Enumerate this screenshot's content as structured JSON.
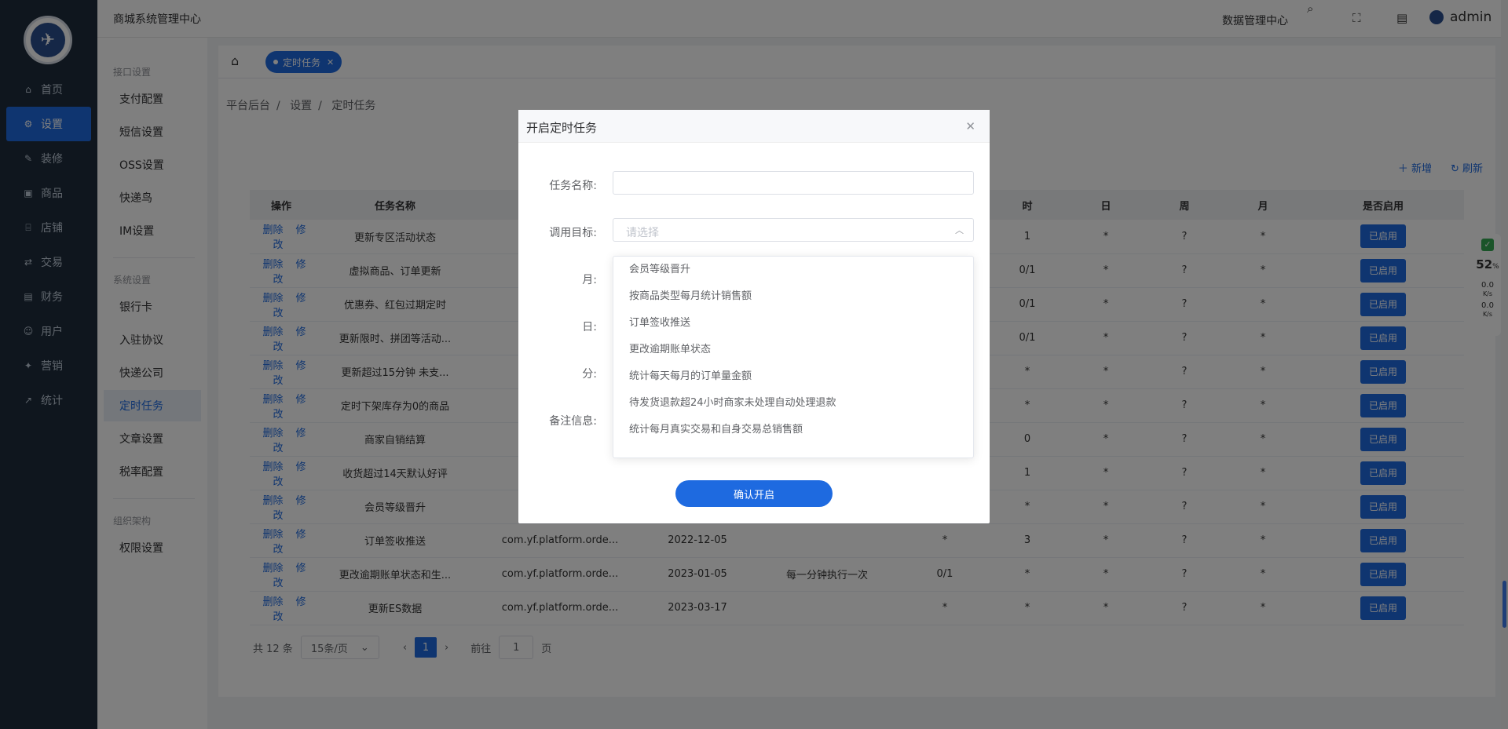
{
  "nav": {
    "items": [
      {
        "label": "首页",
        "icon": "home-icon",
        "glyph": "⌂"
      },
      {
        "label": "设置",
        "icon": "gear-icon",
        "glyph": "⚙"
      },
      {
        "label": "装修",
        "icon": "decorate-icon",
        "glyph": "✎"
      },
      {
        "label": "商品",
        "icon": "goods-icon",
        "glyph": "▣"
      },
      {
        "label": "店铺",
        "icon": "store-icon",
        "glyph": "⌸"
      },
      {
        "label": "交易",
        "icon": "trade-icon",
        "glyph": "⇄"
      },
      {
        "label": "财务",
        "icon": "finance-icon",
        "glyph": "▤"
      },
      {
        "label": "用户",
        "icon": "user-icon",
        "glyph": "☺"
      },
      {
        "label": "营销",
        "icon": "marketing-icon",
        "glyph": "✦"
      },
      {
        "label": "统计",
        "icon": "stats-icon",
        "glyph": "↗"
      }
    ],
    "active_index": 1
  },
  "subnav": {
    "group1": "接口设置",
    "group1_items": [
      "支付配置",
      "短信设置",
      "OSS设置",
      "快递鸟",
      "IM设置"
    ],
    "group2": "系统设置",
    "group2_items": [
      "银行卡",
      "入驻协议",
      "快递公司",
      "定时任务",
      "文章设置",
      "税率配置"
    ],
    "group3": "组织架构",
    "group3_items": [
      "权限设置"
    ]
  },
  "header": {
    "title": "商城系统管理中心",
    "data_center": "数据管理中心",
    "user": "admin"
  },
  "tabs": {
    "active": "定时任务"
  },
  "breadcrumb": [
    "平台后台",
    "设置",
    "定时任务"
  ],
  "toolbar": {
    "add": "＋ 新增",
    "refresh": "↻ 刷新"
  },
  "table": {
    "columns": [
      "操作",
      "任务名称",
      "",
      "",
      "",
      "",
      "时",
      "日",
      "周",
      "月",
      "是否启用"
    ],
    "actions": {
      "delete": "删除",
      "edit": "修改"
    },
    "enabled_label": "已启用",
    "rows": [
      {
        "name": "更新专区活动状态",
        "target": "",
        "date": "",
        "desc": "",
        "min": "",
        "hour": "1",
        "day": "*",
        "week": "?",
        "month": "*"
      },
      {
        "name": "虚拟商品、订单更新",
        "target": "",
        "date": "",
        "desc": "",
        "min": "",
        "hour": "0/1",
        "day": "*",
        "week": "?",
        "month": "*"
      },
      {
        "name": "优惠券、红包过期定时",
        "target": "",
        "date": "",
        "desc": "",
        "min": "",
        "hour": "0/1",
        "day": "*",
        "week": "?",
        "month": "*"
      },
      {
        "name": "更新限时、拼团等活动...",
        "target": "",
        "date": "",
        "desc": "",
        "min": "",
        "hour": "0/1",
        "day": "*",
        "week": "?",
        "month": "*"
      },
      {
        "name": "更新超过15分钟 未支...",
        "target": "",
        "date": "",
        "desc": "",
        "min": "",
        "hour": "*",
        "day": "*",
        "week": "?",
        "month": "*"
      },
      {
        "name": "定时下架库存为0的商品",
        "target": "",
        "date": "",
        "desc": "",
        "min": "",
        "hour": "*",
        "day": "*",
        "week": "?",
        "month": "*"
      },
      {
        "name": "商家自销结算",
        "target": "",
        "date": "",
        "desc": "",
        "min": "",
        "hour": "0",
        "day": "*",
        "week": "?",
        "month": "*"
      },
      {
        "name": "收货超过14天默认好评",
        "target": "",
        "date": "",
        "desc": "",
        "min": "",
        "hour": "1",
        "day": "*",
        "week": "?",
        "month": "*"
      },
      {
        "name": "会员等级晋升",
        "target": "",
        "date": "",
        "desc": "",
        "min": "",
        "hour": "*",
        "day": "*",
        "week": "?",
        "month": "*"
      },
      {
        "name": "订单签收推送",
        "target": "com.yf.platform.orde...",
        "date": "2022-12-05",
        "desc": "",
        "min": "*",
        "hour": "3",
        "day": "*",
        "week": "?",
        "month": "*"
      },
      {
        "name": "更改逾期账单状态和生...",
        "target": "com.yf.platform.orde...",
        "date": "2023-01-05",
        "desc": "每一分钟执行一次",
        "min": "0/1",
        "hour": "*",
        "day": "*",
        "week": "?",
        "month": "*"
      },
      {
        "name": "更新ES数据",
        "target": "com.yf.platform.orde...",
        "date": "2023-03-17",
        "desc": "",
        "min": "*",
        "hour": "*",
        "day": "*",
        "week": "?",
        "month": "*"
      }
    ]
  },
  "pager": {
    "total": "共 12 条",
    "size": "15条/页",
    "page": "1",
    "goto": "前往",
    "goto_value": "1",
    "page_unit": "页"
  },
  "modal": {
    "title": "开启定时任务",
    "task_name_label": "任务名称:",
    "target_label": "调用目标:",
    "target_placeholder": "请选择",
    "month_label": "月:",
    "day_label": "日:",
    "minute_label": "分:",
    "remark_label": "备注信息:",
    "confirm": "确认开启",
    "options": [
      "会员等级晋升",
      "按商品类型每月统计销售额",
      "订单签收推送",
      "更改逾期账单状态",
      "统计每天每月的订单量金额",
      "待发货退款超24小时商家未处理自动处理退款",
      "统计每月真实交易和自身交易总销售额"
    ]
  },
  "widget": {
    "percent": "52",
    "percent_unit": "%",
    "up": "0.0",
    "up_unit": "K/s",
    "down": "0.0",
    "down_unit": "K/s"
  },
  "colors": {
    "primary": "#1e6ae0",
    "nav_bg": "#1f2d3d"
  }
}
